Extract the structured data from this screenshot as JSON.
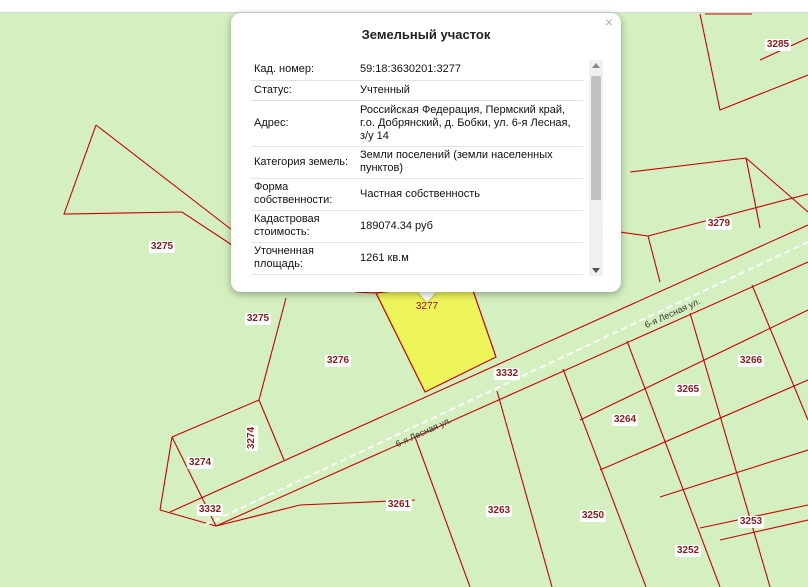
{
  "popup": {
    "title": "Земельный участок",
    "close_glyph": "×",
    "rows": [
      {
        "key": "Кад. номер:",
        "value": "59:18:3630201:3277"
      },
      {
        "key": "Статус:",
        "value": "Учтенный"
      },
      {
        "key": "Адрес:",
        "value": "Российская Федерация, Пермский край, г.о. Добрянский, д. Бобки, ул. 6-я Лесная, з/у 14"
      },
      {
        "key": "Категория земель:",
        "value": "Земли поселений (земли населенных пунктов)"
      },
      {
        "key": "Форма собственности:",
        "value": "Частная собственность"
      },
      {
        "key": "Кадастровая стоимость:",
        "value": "189074.34 руб"
      },
      {
        "key": "Уточненная площадь:",
        "value": "1261 кв.м"
      }
    ]
  },
  "map": {
    "colors": {
      "background": "#d4f0c0",
      "boundary": "#cc0000",
      "selected_fill": "#eef55a",
      "road_center": "#ffffff"
    },
    "parcel_labels": [
      "3285",
      "3279",
      "3275",
      "3275",
      "3276",
      "3277",
      "3332",
      "3266",
      "3265",
      "3264",
      "3274",
      "3274",
      "3332",
      "3261",
      "3263",
      "3250",
      "3253",
      "3252"
    ],
    "street_labels": [
      "6-я Лесная ул.",
      "6-я Лесная ул."
    ]
  }
}
